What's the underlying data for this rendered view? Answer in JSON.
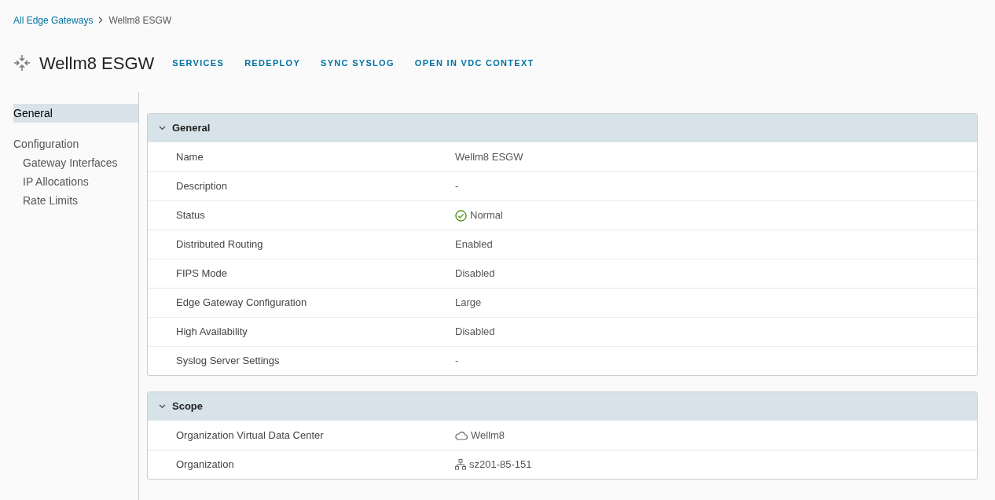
{
  "breadcrumb": [
    {
      "label": "All Edge Gateways",
      "kind": "link"
    },
    {
      "label": "Wellm8 ESGW",
      "kind": "current"
    }
  ],
  "title": "Wellm8 ESGW",
  "actions": [
    "SERVICES",
    "REDEPLOY",
    "SYNC SYSLOG",
    "OPEN IN VDC CONTEXT"
  ],
  "sidebar": {
    "items": [
      {
        "label": "General",
        "selected": true
      },
      {
        "label": "Configuration",
        "selected": false,
        "children": [
          {
            "label": "Gateway Interfaces",
            "selected": false
          },
          {
            "label": "IP Allocations",
            "selected": false
          },
          {
            "label": "Rate Limits",
            "selected": false
          }
        ]
      }
    ]
  },
  "sections": [
    {
      "title": "General",
      "expanded": true,
      "rows": [
        {
          "label": "Name",
          "value": "Wellm8 ESGW"
        },
        {
          "label": "Description",
          "value": "-"
        },
        {
          "label": "Status",
          "value": "Normal",
          "kind": "status-ok"
        },
        {
          "label": "Distributed Routing",
          "value": "Enabled"
        },
        {
          "label": "FIPS Mode",
          "value": "Disabled"
        },
        {
          "label": "Edge Gateway Configuration",
          "value": "Large"
        },
        {
          "label": "High Availability",
          "value": "Disabled"
        },
        {
          "label": "Syslog Server Settings",
          "value": "-"
        }
      ]
    },
    {
      "title": "Scope",
      "expanded": true,
      "rows": [
        {
          "label": "Organization Virtual Data Center",
          "value": "Wellm8",
          "kind": "cloud"
        },
        {
          "label": "Organization",
          "value": "sz201-85-151",
          "kind": "org"
        }
      ]
    }
  ]
}
